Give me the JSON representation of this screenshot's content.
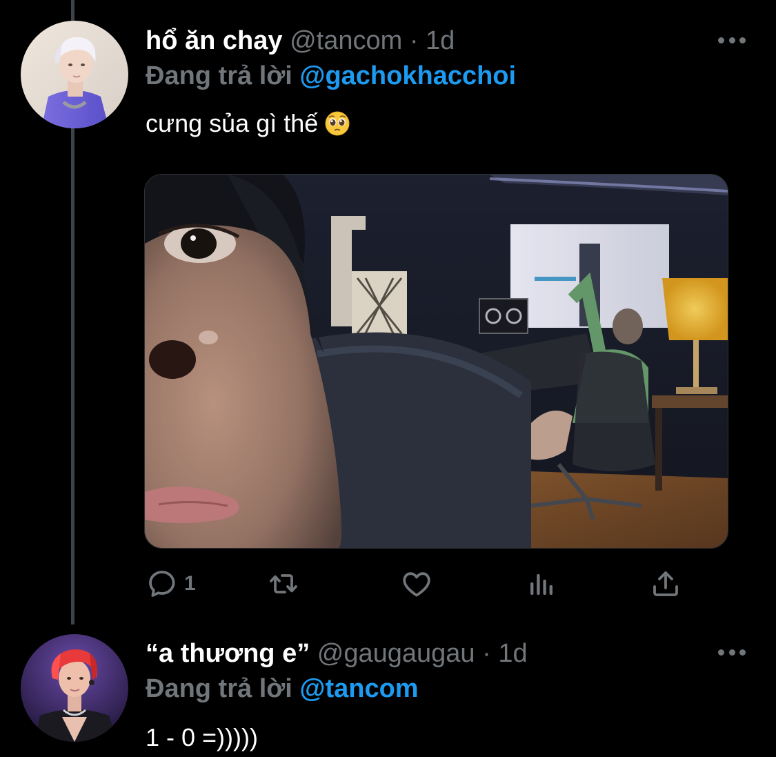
{
  "tweets": [
    {
      "display_name": "hổ ăn chay",
      "handle": "@tancom",
      "separator": "·",
      "time": "1d",
      "reply_prefix": "Đang trả lời",
      "reply_to": "@gachokhacchoi",
      "text": "cưng sủa gì thế",
      "emoji": "pleading-face",
      "avatar": "avatar-white-hair",
      "media": "photo-studio-selfie",
      "actions": {
        "reply_count": "1",
        "retweet_count": "",
        "like_count": "",
        "icons": [
          "reply-icon",
          "retweet-icon",
          "like-icon",
          "analytics-icon",
          "share-icon"
        ]
      }
    },
    {
      "display_name": "“a thương e”",
      "handle": "@gaugaugau",
      "separator": "·",
      "time": "1d",
      "reply_prefix": "Đang trả lời",
      "reply_to": "@tancom",
      "text": "1 - 0 =)))))",
      "avatar": "avatar-red-hair"
    }
  ],
  "colors": {
    "background": "#000000",
    "text_primary": "#ffffff",
    "text_secondary": "#71767b",
    "accent_link": "#1d9bf0",
    "thread_line": "#3d4347"
  }
}
